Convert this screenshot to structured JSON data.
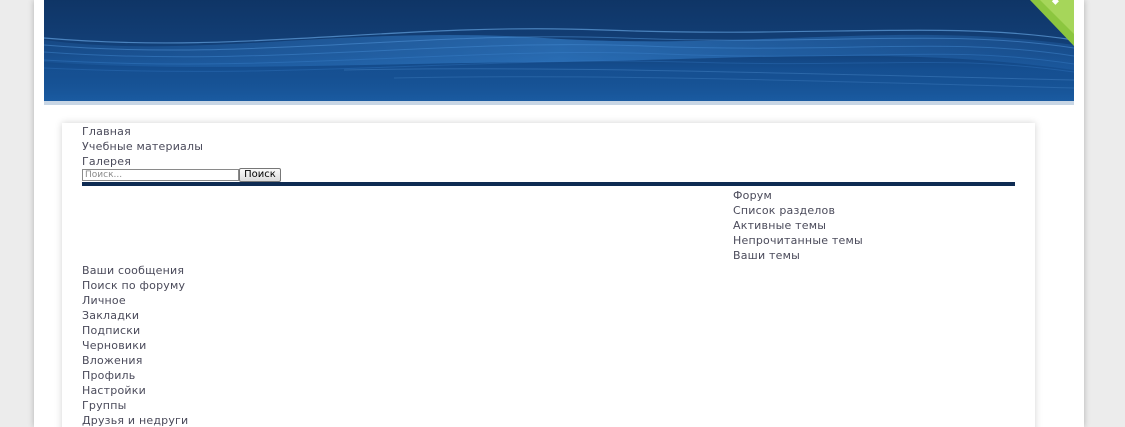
{
  "colors": {
    "header_dark": "#0f3566",
    "header_light": "#1a5aa0",
    "ribbon_green": "#8cc63f",
    "divider": "#0e2b52",
    "link_text": "#4a4a5a"
  },
  "main_nav": {
    "items": [
      "Главная",
      "Учебные материалы",
      "Галерея"
    ]
  },
  "search": {
    "placeholder": "Поиск...",
    "button_label": "Поиск"
  },
  "forum_nav": {
    "items": [
      "Форум",
      "Список разделов",
      "Активные темы",
      "Непрочитанные темы",
      "Ваши темы"
    ]
  },
  "user_nav": {
    "items": [
      "Ваши сообщения",
      "Поиск по форуму",
      "Личное",
      "Закладки",
      "Подписки",
      "Черновики",
      "Вложения",
      "Профиль",
      "Настройки",
      "Группы",
      "Друзья и недруги"
    ]
  }
}
